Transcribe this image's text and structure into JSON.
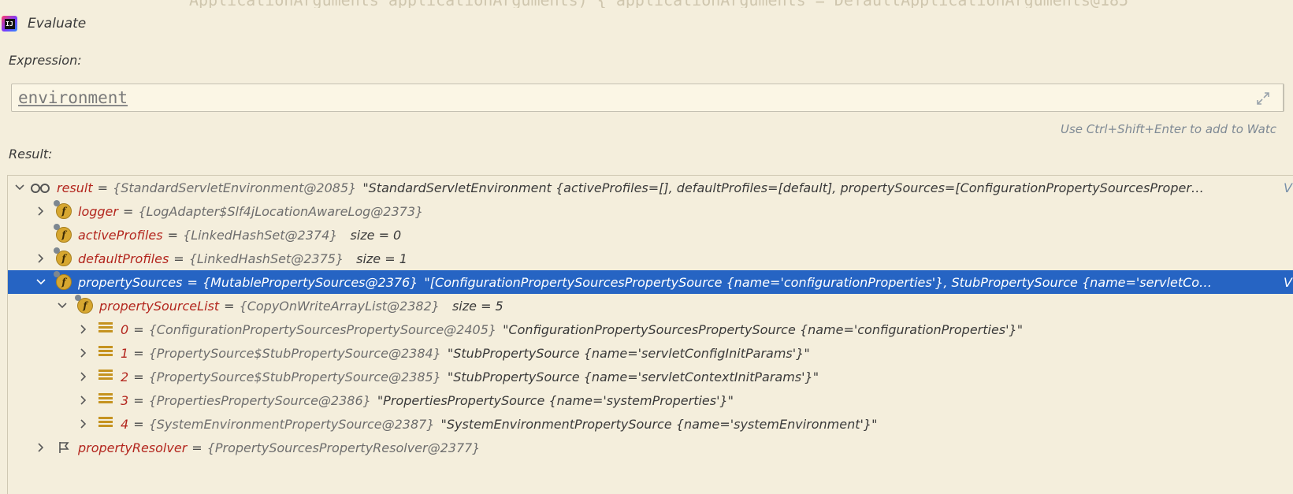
{
  "background_code": "ApplicationArguments applicationArguments) { applicationArguments = DefaultApplicationArguments@185",
  "window": {
    "title": "Evaluate"
  },
  "expression": {
    "label": "Expression:",
    "value": "environment"
  },
  "hint": "Use Ctrl+Shift+Enter to add to Watc",
  "result_label": "Result:",
  "view_link": "V",
  "tree": [
    {
      "name": "result",
      "value": "{StandardServletEnvironment@2085}",
      "str": "\"StandardServletEnvironment {activeProfiles=[], defaultProfiles=[default], propertySources=[ConfigurationPropertySourcesProper…",
      "size": "",
      "expanded": true,
      "icon": "watch-glasses-icon",
      "view": true
    },
    {
      "name": "logger",
      "value": "{LogAdapter$Slf4jLocationAwareLog@2373}",
      "str": "",
      "size": "",
      "expanded": false,
      "icon": "field-icon"
    },
    {
      "name": "activeProfiles",
      "value": "{LinkedHashSet@2374}",
      "str": "",
      "size": "size = 0",
      "expanded": null,
      "icon": "field-icon"
    },
    {
      "name": "defaultProfiles",
      "value": "{LinkedHashSet@2375}",
      "str": "",
      "size": "size = 1",
      "expanded": false,
      "icon": "field-icon"
    },
    {
      "name": "propertySources",
      "value": "{MutablePropertySources@2376}",
      "str": "\"[ConfigurationPropertySourcesPropertySource {name='configurationProperties'}, StubPropertySource {name='servletCo…",
      "size": "",
      "expanded": true,
      "selected": true,
      "icon": "field-icon",
      "view": true
    },
    {
      "name": "propertySourceList",
      "value": "{CopyOnWriteArrayList@2382}",
      "str": "",
      "size": "size = 5",
      "expanded": true,
      "icon": "field-icon"
    },
    {
      "name": "0",
      "value": "{ConfigurationPropertySourcesPropertySource@2405}",
      "str": "\"ConfigurationPropertySourcesPropertySource {name='configurationProperties'}\"",
      "size": "",
      "expanded": false,
      "icon": "array-item-icon"
    },
    {
      "name": "1",
      "value": "{PropertySource$StubPropertySource@2384}",
      "str": "\"StubPropertySource {name='servletConfigInitParams'}\"",
      "size": "",
      "expanded": false,
      "icon": "array-item-icon"
    },
    {
      "name": "2",
      "value": "{PropertySource$StubPropertySource@2385}",
      "str": "\"StubPropertySource {name='servletContextInitParams'}\"",
      "size": "",
      "expanded": false,
      "icon": "array-item-icon"
    },
    {
      "name": "3",
      "value": "{PropertiesPropertySource@2386}",
      "str": "\"PropertiesPropertySource {name='systemProperties'}\"",
      "size": "",
      "expanded": false,
      "icon": "array-item-icon"
    },
    {
      "name": "4",
      "value": "{SystemEnvironmentPropertySource@2387}",
      "str": "\"SystemEnvironmentPropertySource {name='systemEnvironment'}\"",
      "size": "",
      "expanded": false,
      "icon": "array-item-icon"
    },
    {
      "name": "propertyResolver",
      "value": "{PropertySourcesPropertyResolver@2377}",
      "str": "",
      "size": "",
      "expanded": false,
      "icon": "flag-icon"
    }
  ]
}
